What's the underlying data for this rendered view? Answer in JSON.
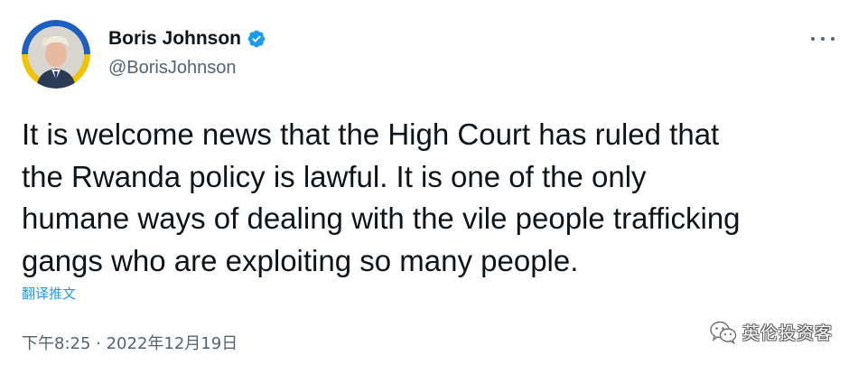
{
  "author": {
    "display_name": "Boris Johnson",
    "handle": "@BorisJohnson",
    "verified": true,
    "avatar_icon": "profile-photo",
    "avatar_ring_colors": [
      "#1f5fbf",
      "#f2c300"
    ]
  },
  "tweet": {
    "text_lines": [
      "It is welcome news that the High Court has ruled that",
      "the Rwanda policy is lawful. It is one of the only",
      "humane ways of dealing with the vile people trafficking",
      "gangs who are exploiting so many people."
    ],
    "translate_label": "翻译推文",
    "timestamp": "下午8:25 · 2022年12月19日"
  },
  "more_menu": {
    "icon": "more-horizontal-icon"
  },
  "watermark": {
    "text": "英伦投资客",
    "icon": "wechat-icon"
  },
  "colors": {
    "text": "#0f1419",
    "secondary": "#536471",
    "link": "#1d9bf0",
    "verified": "#1d9bf0"
  }
}
